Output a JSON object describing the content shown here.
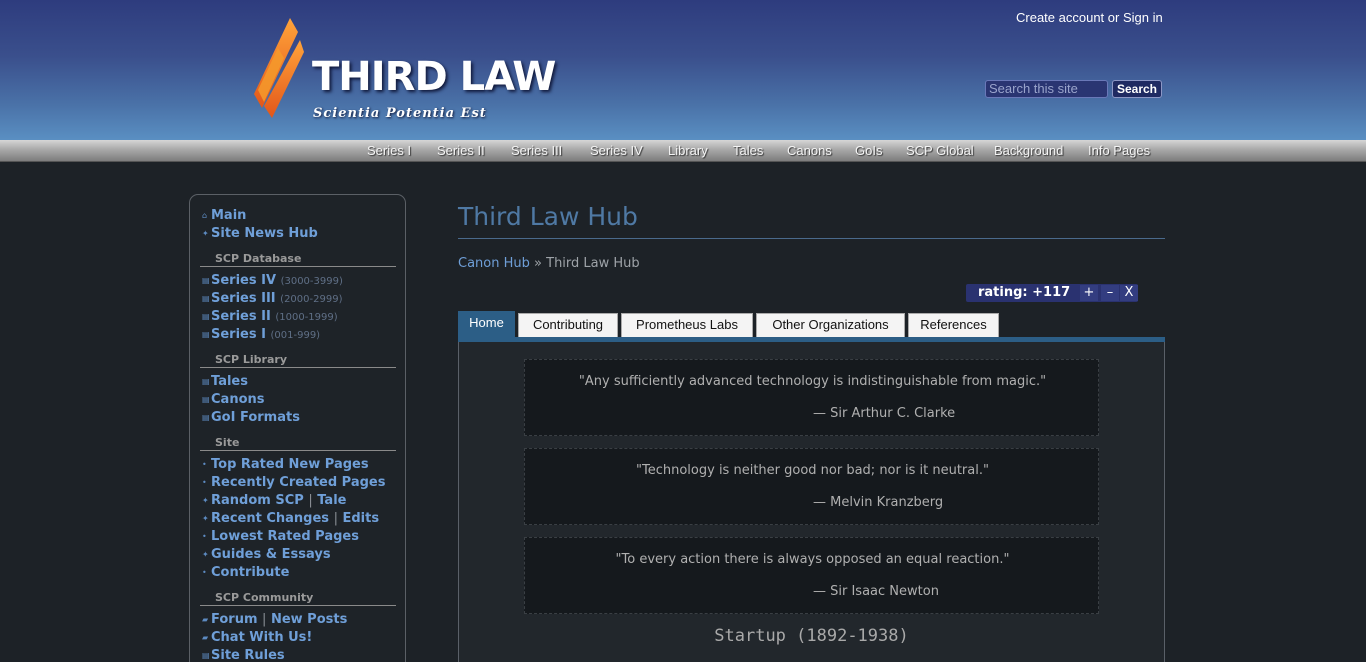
{
  "header": {
    "site_title": "THIRD LAW",
    "tagline": "Scientia Potentia Est",
    "account_link": "Create account or Sign in",
    "search_placeholder": "Search this site",
    "search_button": "Search"
  },
  "top_nav": [
    "Series I",
    "Series II",
    "Series III",
    "Series IV",
    "Library",
    "Tales",
    "Canons",
    "GoIs",
    "SCP Global",
    "Background",
    "Info Pages"
  ],
  "sidebar": {
    "main": "Main",
    "site_news_hub": "Site News Hub",
    "scp_database_heading": "SCP Database",
    "series": [
      {
        "label": "Series IV",
        "range": "(3000-3999)"
      },
      {
        "label": "Series III",
        "range": "(2000-2999)"
      },
      {
        "label": "Series II",
        "range": "(1000-1999)"
      },
      {
        "label": "Series I",
        "range": "(001-999)"
      }
    ],
    "scp_library_heading": "SCP Library",
    "library": [
      "Tales",
      "Canons",
      "GoI Formats"
    ],
    "site_heading": "Site",
    "site_links": {
      "top_rated": "Top Rated New Pages",
      "recently_created": "Recently Created Pages",
      "random_scp": "Random SCP",
      "tale": "Tale",
      "recent_changes": "Recent Changes",
      "edits": "Edits",
      "lowest_rated": "Lowest Rated Pages",
      "guides": "Guides & Essays",
      "contribute": "Contribute"
    },
    "scp_community_heading": "SCP Community",
    "community": {
      "forum": "Forum",
      "new_posts": "New Posts",
      "chat": "Chat With Us!",
      "rules": "Site Rules"
    },
    "separator": "|"
  },
  "page": {
    "title": "Third Law Hub",
    "breadcrumb_parent": "Canon Hub",
    "breadcrumb_sep": "»",
    "breadcrumb_current": "Third Law Hub",
    "rating_label": "rating: +117",
    "rate_up": "+",
    "rate_down": "–",
    "rate_cancel": "X"
  },
  "tabs": [
    "Home",
    "Contributing",
    "Prometheus Labs",
    "Other Organizations",
    "References"
  ],
  "quotes": [
    {
      "text": "\"Any sufficiently advanced technology is indistinguishable from magic.\"",
      "author": "— Sir Arthur C. Clarke"
    },
    {
      "text": "\"Technology is neither good nor bad; nor is it neutral.\"",
      "author": "— Melvin Kranzberg"
    },
    {
      "text": "\"To every action there is always opposed an equal reaction.\"",
      "author": "— Sir Isaac Newton"
    }
  ],
  "section_heading": "Startup (1892-1938)",
  "colors": {
    "accent": "#4f79a4",
    "link": "#6f9fd8",
    "tab_active": "#2c5e86",
    "logo_orange": "#f07a1a"
  }
}
